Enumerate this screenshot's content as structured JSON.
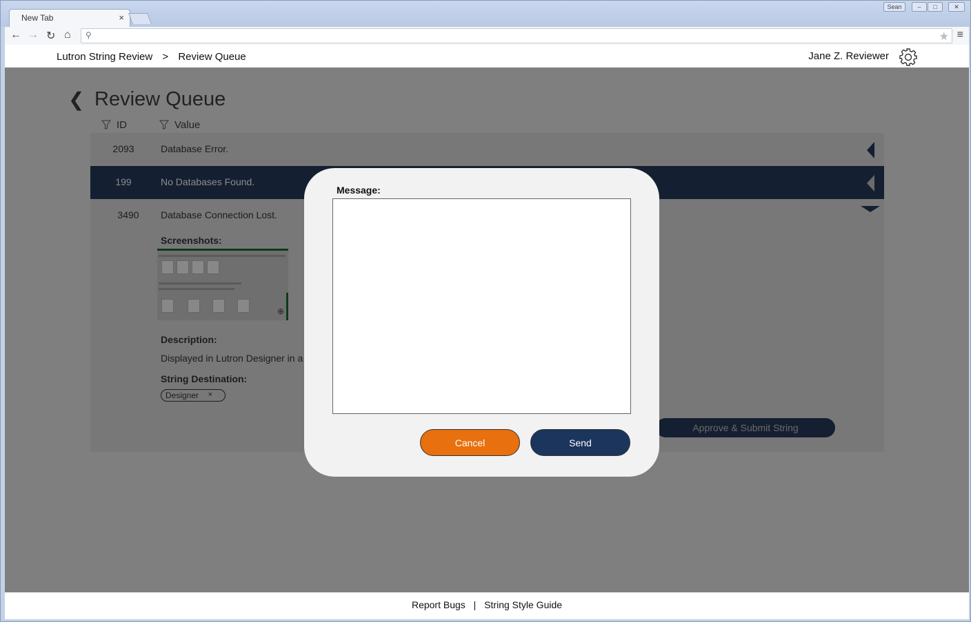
{
  "browser": {
    "tab_title": "New Tab",
    "tab_close": "×",
    "window_buttons": [
      "Sean",
      "–",
      "□",
      "✕"
    ],
    "url": ""
  },
  "header": {
    "breadcrumb": [
      "Lutron String Review",
      ">",
      "Review Queue"
    ],
    "user_name": "Jane Z. Reviewer"
  },
  "main": {
    "title": "Review Queue",
    "back_glyph": "❮",
    "columns": [
      "ID",
      "Value"
    ],
    "rows": [
      {
        "id": "2093",
        "value": "Database Error."
      },
      {
        "id": "199",
        "value": "No Databases Found."
      }
    ],
    "expanded": {
      "id": "3490",
      "value": "Database Connection Lost.",
      "screenshots_label": "Screenshots:",
      "description_label": "Description:",
      "description": "Displayed in Lutron Designer in a",
      "destination_label": "String Destination:",
      "destination_chip": "Designer",
      "chip_remove": "×",
      "approve_label": "Approve & Submit String"
    }
  },
  "footer": {
    "links": [
      "Report Bugs",
      "|",
      "String Style Guide"
    ]
  },
  "modal": {
    "label": "Message:",
    "message_value": "",
    "cancel_label": "Cancel",
    "send_label": "Send"
  },
  "colors": {
    "selected_row": "#141f31",
    "cancel": "#e8700e",
    "send": "#1b355c",
    "overlay": "#7f7f7f"
  }
}
